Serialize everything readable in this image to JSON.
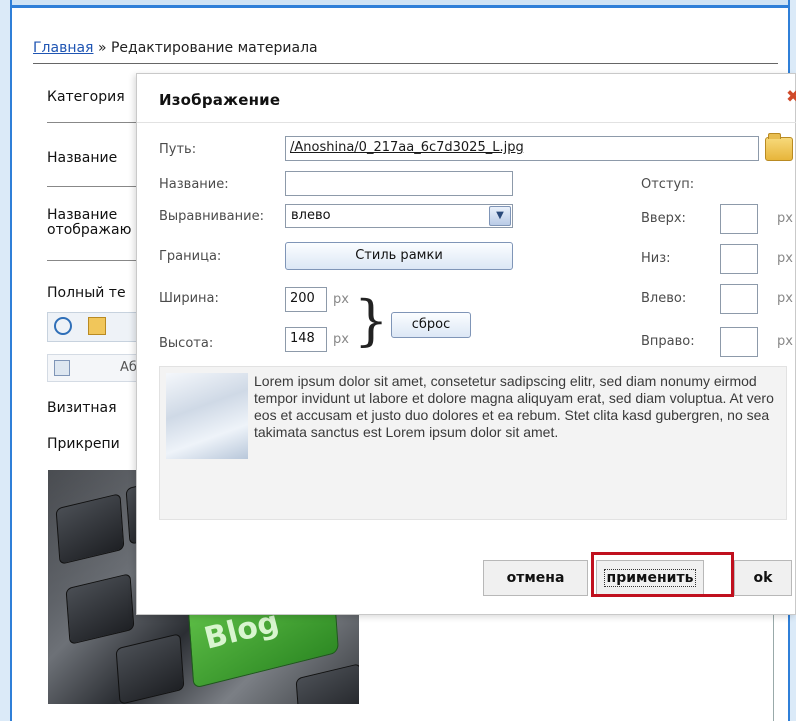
{
  "breadcrumb": {
    "home": "Главная",
    "separator": "»",
    "current": "Редактирование материала"
  },
  "background_form": {
    "category_label": "Категория",
    "name_label": "Название",
    "name_display_label_line1": "Название",
    "name_display_label_line2": "отображаю",
    "full_text_label": "Полный те",
    "toolbar_row2_text": "Аб",
    "content_text_1": "Визитная",
    "content_text_2": "Прикрепи",
    "photo_text": "Blog"
  },
  "dialog": {
    "title": "Изображение",
    "close_label": "✖",
    "fields": {
      "path_label": "Путь:",
      "path_value": "/Anoshina/0_217aa_6c7d3025_L.jpg",
      "name_label": "Название:",
      "name_value": "",
      "align_label": "Выравнивание:",
      "align_value": "влево",
      "border_label": "Граница:",
      "border_button": "Стиль рамки",
      "width_label": "Ширина:",
      "width_value": "200",
      "height_label": "Высота:",
      "height_value": "148",
      "unit": "px",
      "reset_button": "сброс"
    },
    "margins": {
      "title": "Отступ:",
      "top_label": "Вверх:",
      "bottom_label": "Низ:",
      "left_label": "Влево:",
      "right_label": "Вправо:",
      "top_value": "",
      "bottom_value": "",
      "left_value": "",
      "right_value": "",
      "unit": "px"
    },
    "preview_text": "Lorem ipsum dolor sit amet, consetetur sadipscing elitr, sed diam nonumy eirmod tempor invidunt ut labore et dolore magna aliquyam erat, sed diam voluptua. At vero eos et accusam et justo duo dolores et ea rebum. Stet clita kasd gubergren, no sea takimata sanctus est Lorem ipsum dolor sit amet.",
    "buttons": {
      "cancel": "отмена",
      "apply": "применить",
      "ok": "ok"
    }
  },
  "colors": {
    "accent_border": "#2f7fd8",
    "highlight": "#c0101e",
    "link": "#1f55b3"
  }
}
